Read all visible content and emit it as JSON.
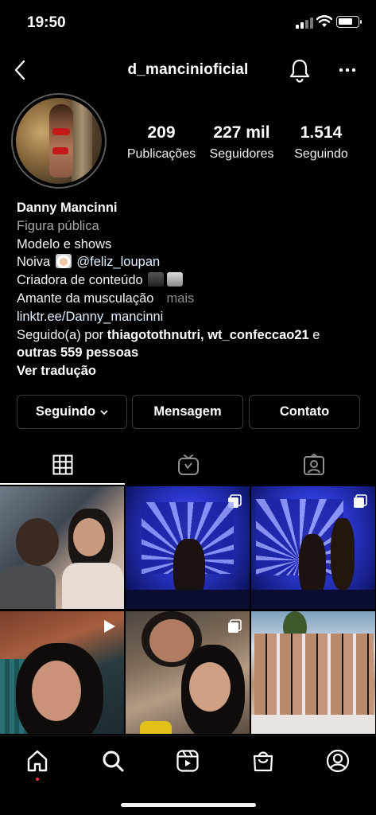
{
  "status_bar": {
    "time": "19:50"
  },
  "header": {
    "username": "d_mancinioficial"
  },
  "stats": {
    "posts": {
      "value": "209",
      "label": "Publicações"
    },
    "followers": {
      "value": "227 mil",
      "label": "Seguidores"
    },
    "following": {
      "value": "1.514",
      "label": "Seguindo"
    }
  },
  "bio": {
    "name": "Danny Mancinni",
    "category": "Figura pública",
    "line1": "Modelo e shows",
    "line2_prefix": "Noiva",
    "line2_mention": "@feliz_loupan",
    "line3": "Criadora de conteúdo",
    "line4": "Amante da musculação",
    "line4_more": "mais",
    "link": "linktr.ee/Danny_mancinni",
    "followed_by_prefix": "Seguido(a) por",
    "followed_by_users": "thiagotothnutri, wt_confeccao21",
    "followed_by_and": "e",
    "followed_by_others": "outras 559 pessoas",
    "see_translation": "Ver tradução"
  },
  "buttons": {
    "following": "Seguindo",
    "message": "Mensagem",
    "contact": "Contato"
  },
  "tabs": [
    "grid-icon",
    "igtv-icon",
    "tagged-icon"
  ],
  "grid_posts": [
    {
      "type": "photo"
    },
    {
      "type": "carousel"
    },
    {
      "type": "carousel"
    },
    {
      "type": "reel"
    },
    {
      "type": "carousel"
    },
    {
      "type": "photo"
    }
  ],
  "bottom_nav": [
    "home-icon",
    "search-icon",
    "reels-icon",
    "shop-icon",
    "profile-icon"
  ],
  "colors": {
    "background": "#000000",
    "notification_dot": "#ff3040",
    "link": "#e0f1ff"
  }
}
